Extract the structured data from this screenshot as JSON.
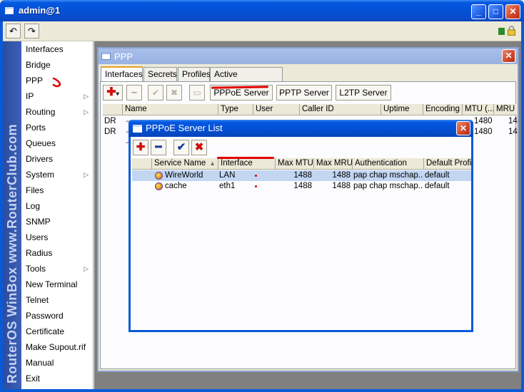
{
  "main_window": {
    "title": "admin@1"
  },
  "toolbar": {
    "undo_icon": "undo-icon",
    "redo_icon": "redo-icon",
    "status_color": "#2a8a2a"
  },
  "brand": {
    "text": "RouterOS WinBox   www.RouterClub.com"
  },
  "nav": {
    "items": [
      {
        "label": "Interfaces",
        "submenu": false
      },
      {
        "label": "Bridge",
        "submenu": false
      },
      {
        "label": "PPP",
        "submenu": false
      },
      {
        "label": "IP",
        "submenu": true
      },
      {
        "label": "Routing",
        "submenu": true
      },
      {
        "label": "Ports",
        "submenu": false
      },
      {
        "label": "Queues",
        "submenu": false
      },
      {
        "label": "Drivers",
        "submenu": false
      },
      {
        "label": "System",
        "submenu": true
      },
      {
        "label": "Files",
        "submenu": false
      },
      {
        "label": "Log",
        "submenu": false
      },
      {
        "label": "SNMP",
        "submenu": false
      },
      {
        "label": "Users",
        "submenu": false
      },
      {
        "label": "Radius",
        "submenu": false
      },
      {
        "label": "Tools",
        "submenu": true
      },
      {
        "label": "New Terminal",
        "submenu": false
      },
      {
        "label": "Telnet",
        "submenu": false
      },
      {
        "label": "Password",
        "submenu": false
      },
      {
        "label": "Certificate",
        "submenu": false
      },
      {
        "label": "Make Supout.rif",
        "submenu": false
      },
      {
        "label": "Manual",
        "submenu": false
      },
      {
        "label": "Exit",
        "submenu": false
      }
    ]
  },
  "ppp_window": {
    "title": "PPP",
    "tabs": [
      "Interfaces",
      "Secrets",
      "Profiles",
      "Active Connections"
    ],
    "active_tab": "Interfaces",
    "buttons": {
      "pppoe_server": "PPPoE Server",
      "pptp_server": "PPTP Server",
      "l2tp_server": "L2TP Server"
    },
    "columns": [
      "Name",
      "Type",
      "User",
      "Caller ID",
      "Uptime",
      "Encoding",
      "MTU (...",
      "MRU"
    ],
    "rows": [
      {
        "flag": "DR",
        "mtu": "1480",
        "mru": "14"
      },
      {
        "flag": "DR",
        "mtu": "1480",
        "mru": "14"
      }
    ]
  },
  "pppoe_window": {
    "title": "PPPoE Server List",
    "columns": [
      "Service Name",
      "Interface",
      "Max MTU",
      "Max MRU",
      "Authentication",
      "Default Profile"
    ],
    "rows": [
      {
        "service": "WireWorld",
        "interface": "LAN",
        "mtu": "1488",
        "mru": "1488",
        "auth": "pap chap mschap...",
        "profile": "default"
      },
      {
        "service": "cache",
        "interface": "eth1",
        "mtu": "1488",
        "mru": "1488",
        "auth": "pap chap mschap...",
        "profile": "default"
      }
    ]
  }
}
